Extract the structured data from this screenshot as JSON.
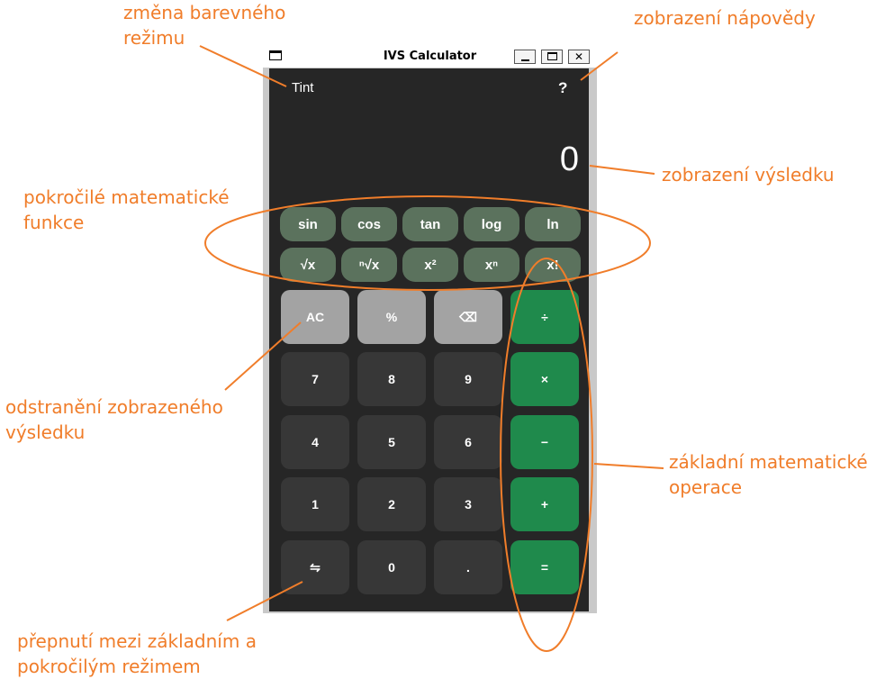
{
  "annotations": {
    "color_mode": "změna barevného\nrežimu",
    "help": "zobrazení nápovědy",
    "result_display": "zobrazení výsledku",
    "advanced_functions": "pokročilé matematické\nfunkce",
    "clear_result": "odstranění zobrazeného\nvýsledku",
    "basic_operations": "základní matematické\noperace",
    "mode_switch": "přepnutí mezi základním a\npokročilým režimem"
  },
  "window": {
    "title": "IVS Calculator",
    "min_label": "",
    "max_label": "",
    "close_label": "✕"
  },
  "calculator": {
    "tint_label": "Tint",
    "help_label": "?",
    "result": "0",
    "advanced_row1": [
      "sin",
      "cos",
      "tan",
      "log",
      "ln"
    ],
    "advanced_row2": [
      "√x",
      "ⁿ√x",
      "x²",
      "xⁿ",
      "x!"
    ],
    "keys": {
      "ac": "AC",
      "percent": "%",
      "backspace": "⌫",
      "divide": "÷",
      "seven": "7",
      "eight": "8",
      "nine": "9",
      "multiply": "×",
      "four": "4",
      "five": "5",
      "six": "6",
      "minus": "−",
      "one": "1",
      "two": "2",
      "three": "3",
      "plus": "+",
      "swap": "⇋",
      "zero": "0",
      "dot": ".",
      "equals": "="
    }
  },
  "colors": {
    "annotation": "#f07d2a",
    "background": "#262626",
    "advanced_button": "#5b725d",
    "operator_button": "#1f8a4c",
    "utility_button": "#a3a3a3",
    "digit_button": "#373737"
  }
}
